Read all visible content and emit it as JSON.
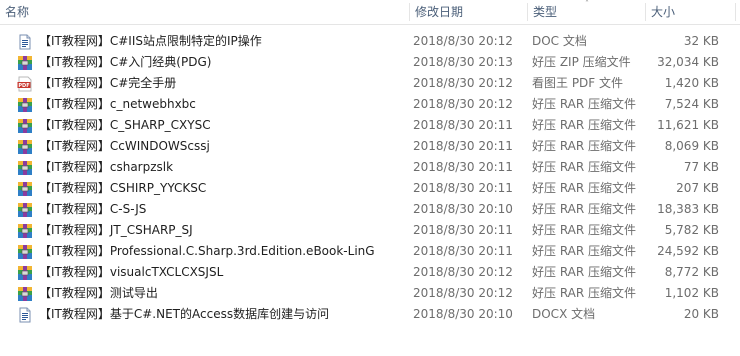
{
  "columns": {
    "name": "名称",
    "date": "修改日期",
    "type": "类型",
    "size": "大小"
  },
  "files": [
    {
      "name": "【IT教程网】C#IIS站点限制特定的IP操作",
      "date": "2018/8/30 20:12",
      "type": "DOC 文档",
      "size": "32 KB",
      "icon": "doc-icon"
    },
    {
      "name": "【IT教程网】C#入门经典(PDG)",
      "date": "2018/8/30 20:13",
      "type": "好压 ZIP 压缩文件",
      "size": "32,034 KB",
      "icon": "archive-icon"
    },
    {
      "name": "【IT教程网】C#完全手册",
      "date": "2018/8/30 20:12",
      "type": "看图王 PDF 文件",
      "size": "1,420 KB",
      "icon": "pdf-icon"
    },
    {
      "name": "【IT教程网】c_netwebhxbc",
      "date": "2018/8/30 20:12",
      "type": "好压 RAR 压缩文件",
      "size": "7,524 KB",
      "icon": "archive-icon"
    },
    {
      "name": "【IT教程网】C_SHARP_CXYSC",
      "date": "2018/8/30 20:11",
      "type": "好压 RAR 压缩文件",
      "size": "11,621 KB",
      "icon": "archive-icon"
    },
    {
      "name": "【IT教程网】CcWINDOWScssj",
      "date": "2018/8/30 20:11",
      "type": "好压 RAR 压缩文件",
      "size": "8,069 KB",
      "icon": "archive-icon"
    },
    {
      "name": "【IT教程网】csharpzslk",
      "date": "2018/8/30 20:11",
      "type": "好压 RAR 压缩文件",
      "size": "77 KB",
      "icon": "archive-icon"
    },
    {
      "name": "【IT教程网】CSHIRP_YYCKSC",
      "date": "2018/8/30 20:11",
      "type": "好压 RAR 压缩文件",
      "size": "207 KB",
      "icon": "archive-icon"
    },
    {
      "name": "【IT教程网】C-S-JS",
      "date": "2018/8/30 20:10",
      "type": "好压 RAR 压缩文件",
      "size": "18,383 KB",
      "icon": "archive-icon"
    },
    {
      "name": "【IT教程网】JT_CSHARP_SJ",
      "date": "2018/8/30 20:11",
      "type": "好压 RAR 压缩文件",
      "size": "5,782 KB",
      "icon": "archive-icon"
    },
    {
      "name": "【IT教程网】Professional.C.Sharp.3rd.Edition.eBook-LinG",
      "date": "2018/8/30 20:11",
      "type": "好压 RAR 压缩文件",
      "size": "24,592 KB",
      "icon": "archive-icon"
    },
    {
      "name": "【IT教程网】visualcTXCLCXSJSL",
      "date": "2018/8/30 20:12",
      "type": "好压 RAR 压缩文件",
      "size": "8,772 KB",
      "icon": "archive-icon"
    },
    {
      "name": "【IT教程网】测试导出",
      "date": "2018/8/30 20:12",
      "type": "好压 RAR 压缩文件",
      "size": "1,102 KB",
      "icon": "archive-icon"
    },
    {
      "name": "【IT教程网】基于C#.NET的Access数据库创建与访问",
      "date": "2018/8/30 20:10",
      "type": "DOCX 文档",
      "size": "20 KB",
      "icon": "doc-icon"
    }
  ],
  "colors": {
    "header_text": "#4c607a",
    "row_text": "#1e1e1e",
    "meta_text": "#6d6d6d",
    "pdf_red": "#c8362d",
    "doc_blue": "#2b5797"
  }
}
